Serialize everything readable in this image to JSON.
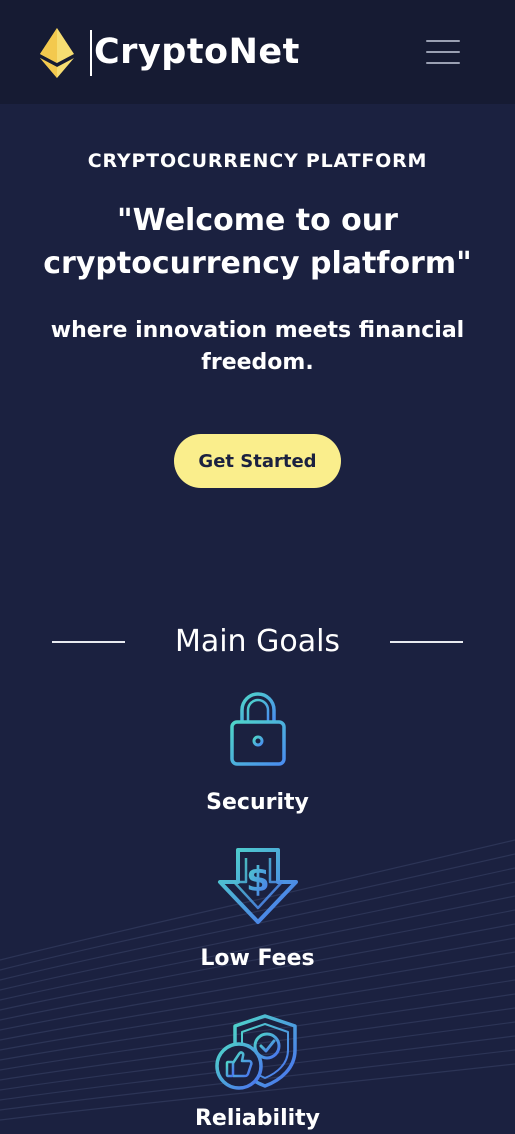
{
  "navbar": {
    "brand": "CryptoNet",
    "logo_icon": "ethereum-diamond-icon",
    "menu_icon": "hamburger-menu-icon"
  },
  "hero": {
    "eyebrow": "CRYPTOCURRENCY PLATFORM",
    "title": "\"Welcome to our cryptocurrency platform\"",
    "subtitle": "where innovation meets financial freedom.",
    "cta_label": "Get Started"
  },
  "goals": {
    "heading": "Main Goals",
    "items": [
      {
        "label": "Security",
        "icon": "padlock-icon"
      },
      {
        "label": "Low Fees",
        "icon": "dollar-down-arrow-icon"
      },
      {
        "label": "Reliability",
        "icon": "shield-thumbs-up-icon"
      }
    ]
  },
  "colors": {
    "background": "#1b2140",
    "navbar": "#161b33",
    "cta": "#faee8c",
    "logo": "#f3d96b",
    "icon_gradient_start": "#4fd6c8",
    "icon_gradient_end": "#4a6ff0"
  }
}
